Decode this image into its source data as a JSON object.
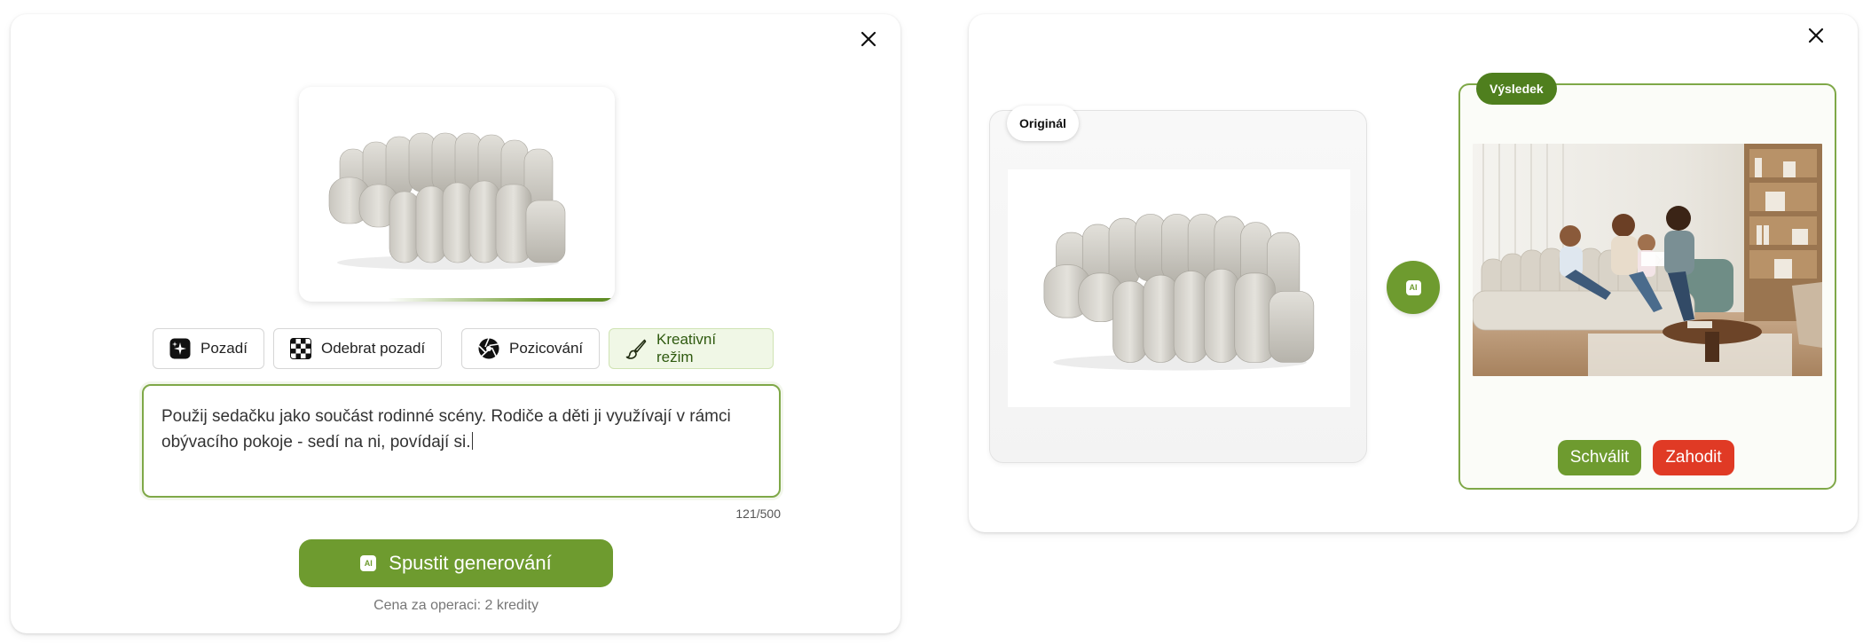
{
  "left_panel": {
    "modes": [
      {
        "label": "Pozadí",
        "icon": "sparkle-square-icon",
        "active": false
      },
      {
        "label": "Odebrat pozadí",
        "icon": "checkerboard-icon",
        "active": false
      },
      {
        "label": "Pozicování",
        "icon": "aperture-icon",
        "active": false
      },
      {
        "label": "Kreativní režim",
        "icon": "brush-icon",
        "active": true
      }
    ],
    "prompt": {
      "value": "Použij sedačku jako součást rodinné scény. Rodiče a děti ji využívají v rámci obývacího pokoje - sedí na ni, povídají si."
    },
    "counter": "121/500",
    "generate": {
      "label": "Spustit generování",
      "ai_badge": "AI"
    },
    "price": "Cena za operaci: 2 kredity"
  },
  "right_panel": {
    "original_label": "Originál",
    "result_label": "Výsledek",
    "ai_badge": "AI",
    "approve_label": "Schválit",
    "discard_label": "Zahodit"
  },
  "colors": {
    "accent_green": "#6e9b2f",
    "dark_green": "#4f7f1e",
    "danger_red": "#e03a25",
    "active_mode_bg": "#f0f7e6"
  }
}
